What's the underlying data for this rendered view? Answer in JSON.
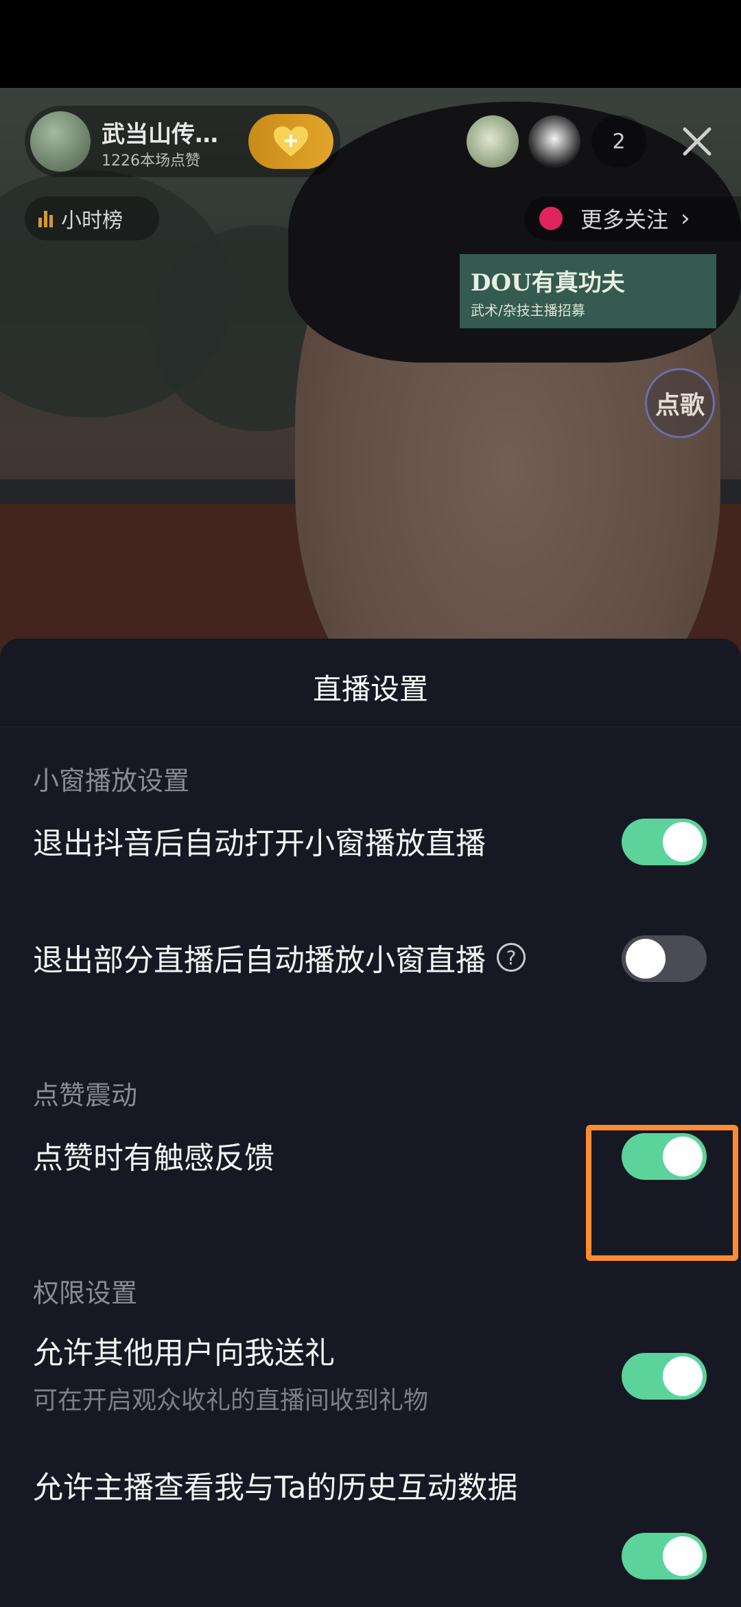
{
  "live": {
    "host_name": "武当山传…",
    "host_likes": "1226本场点赞",
    "viewer_count": "2",
    "rank_label": "小时榜",
    "more_follow_label": "更多关注",
    "banner_title": "DOU有真功夫",
    "banner_subtitle": "武术/杂技主播招募",
    "song_button": "点歌"
  },
  "sheet": {
    "title": "直播设置",
    "sections": [
      {
        "header": "小窗播放设置",
        "items": [
          {
            "label": "退出抖音后自动打开小窗播放直播",
            "toggle": "on"
          },
          {
            "label": "退出部分直播后自动播放小窗直播",
            "toggle": "off",
            "help_icon": "?"
          }
        ]
      },
      {
        "header": "点赞震动",
        "items": [
          {
            "label": "点赞时有触感反馈",
            "toggle": "on"
          }
        ]
      },
      {
        "header": "权限设置",
        "items": [
          {
            "label": "允许其他用户向我送礼",
            "subtitle": "可在开启观众收礼的直播间收到礼物",
            "toggle": "on"
          },
          {
            "label": "允许主播查看我与Ta的历史互动数据",
            "toggle": "on"
          }
        ]
      }
    ]
  },
  "colors": {
    "toggle_on": "#5bd39b",
    "toggle_off": "#4a4b54",
    "sheet_bg": "#161823",
    "highlight": "#ff8c32"
  }
}
